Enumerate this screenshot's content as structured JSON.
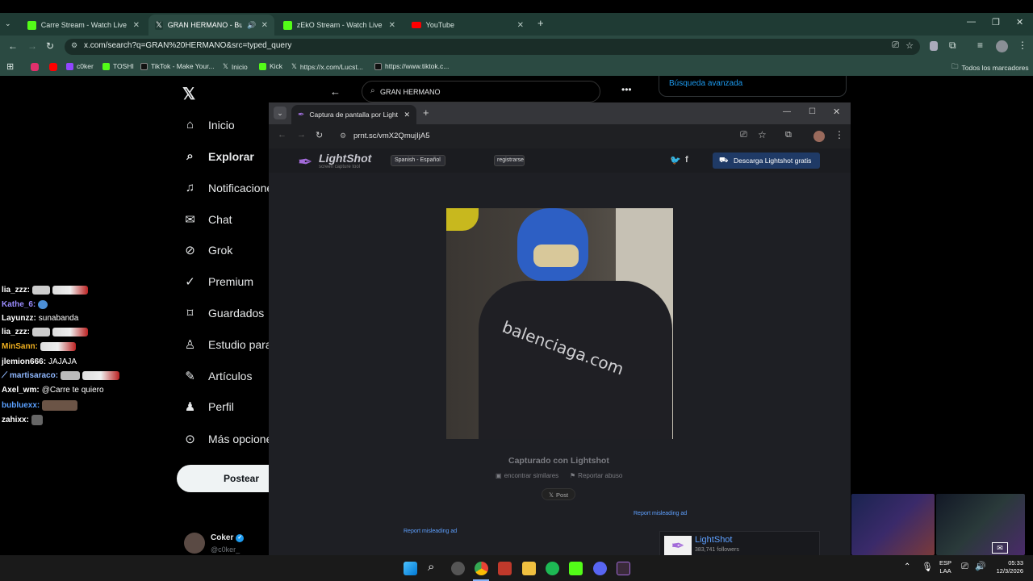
{
  "outer_browser": {
    "tabs": [
      {
        "title": "Carre Stream - Watch Live on Ki",
        "active": false,
        "favicon_color": "#53fc18"
      },
      {
        "title": "GRAN HERMANO - Buscar",
        "active": true,
        "favicon_color": "#ffffff"
      },
      {
        "title": "zEkO Stream - Watch Live on Ki",
        "active": false,
        "favicon_color": "#53fc18"
      },
      {
        "title": "YouTube",
        "active": false,
        "favicon_color": "#ff0000"
      }
    ],
    "url": "x.com/search?q=GRAN%20HERMANO&src=typed_query",
    "bookmarks": [
      "c0ker",
      "TOSHI",
      "TikTok - Make Your...",
      "Inicio",
      "Kick",
      "https://x.com/Lucst...",
      "https://www.tiktok.c..."
    ],
    "all_bookmarks": "Todos los marcadores"
  },
  "x_page": {
    "search_value": "GRAN HERMANO",
    "advanced_search": "Búsqueda avanzada",
    "nav": [
      {
        "label": "Inicio",
        "icon": "home-icon"
      },
      {
        "label": "Explorar",
        "icon": "search-icon"
      },
      {
        "label": "Notificaciones",
        "icon": "bell-icon"
      },
      {
        "label": "Chat",
        "icon": "mail-icon"
      },
      {
        "label": "Grok",
        "icon": "grok-icon"
      },
      {
        "label": "Premium",
        "icon": "premium-icon"
      },
      {
        "label": "Guardados",
        "icon": "bookmark-icon"
      },
      {
        "label": "Estudio para",
        "icon": "studio-icon"
      },
      {
        "label": "Artículos",
        "icon": "article-icon"
      },
      {
        "label": "Perfil",
        "icon": "person-icon"
      },
      {
        "label": "Más opciones",
        "icon": "more-icon"
      }
    ],
    "post_button": "Postear",
    "profile": {
      "name": "Coker",
      "handle": "@c0ker_"
    }
  },
  "chat": [
    {
      "user": "lia_zzz:",
      "text": "",
      "color": "#ffffff"
    },
    {
      "user": "Kathe_6:",
      "text": "",
      "color": "#9b8cff"
    },
    {
      "user": "Layunzz:",
      "text": "sunabanda",
      "color": "#ffffff"
    },
    {
      "user": "lia_zzz:",
      "text": "",
      "color": "#ffffff"
    },
    {
      "user": "MinSann:",
      "text": "",
      "color": "#f0b020"
    },
    {
      "user": "jlemion666:",
      "text": "JAJAJA",
      "color": "#ffffff"
    },
    {
      "user": "martisaraco:",
      "text": "",
      "color": "#8fb8ff"
    },
    {
      "user": "Axel_wm:",
      "text": "@Carre te quiero",
      "color": "#ffffff"
    },
    {
      "user": "bubluexx:",
      "text": "",
      "color": "#5aa0ff"
    },
    {
      "user": "zahixx:",
      "text": "",
      "color": "#ffffff"
    }
  ],
  "inner_browser": {
    "tab_title": "Captura de pantalla por Lightsh",
    "url": "prnt.sc/vmX2QmujIjA5",
    "lightshot": {
      "brand": "LightShot",
      "tagline": "screen capture tool",
      "language": "Spanish - Español",
      "register": "registrarse",
      "download": "Descarga Lightshot gratis",
      "captured_with": "Capturado con Lightshot",
      "find_similar": "encontrar similares",
      "report_abuse": "Reportar abuso",
      "post": "Post",
      "report_ad_1": "Report misleading ad",
      "report_ad_2": "Report misleading ad",
      "fb_name": "LightShot",
      "fb_followers": "383,741 followers",
      "hoodie_text": "balenciaga.com"
    }
  },
  "taskbar": {
    "lang": "ESP",
    "lang2": "LAA",
    "time": "05:33",
    "date": "12/3/2026"
  }
}
